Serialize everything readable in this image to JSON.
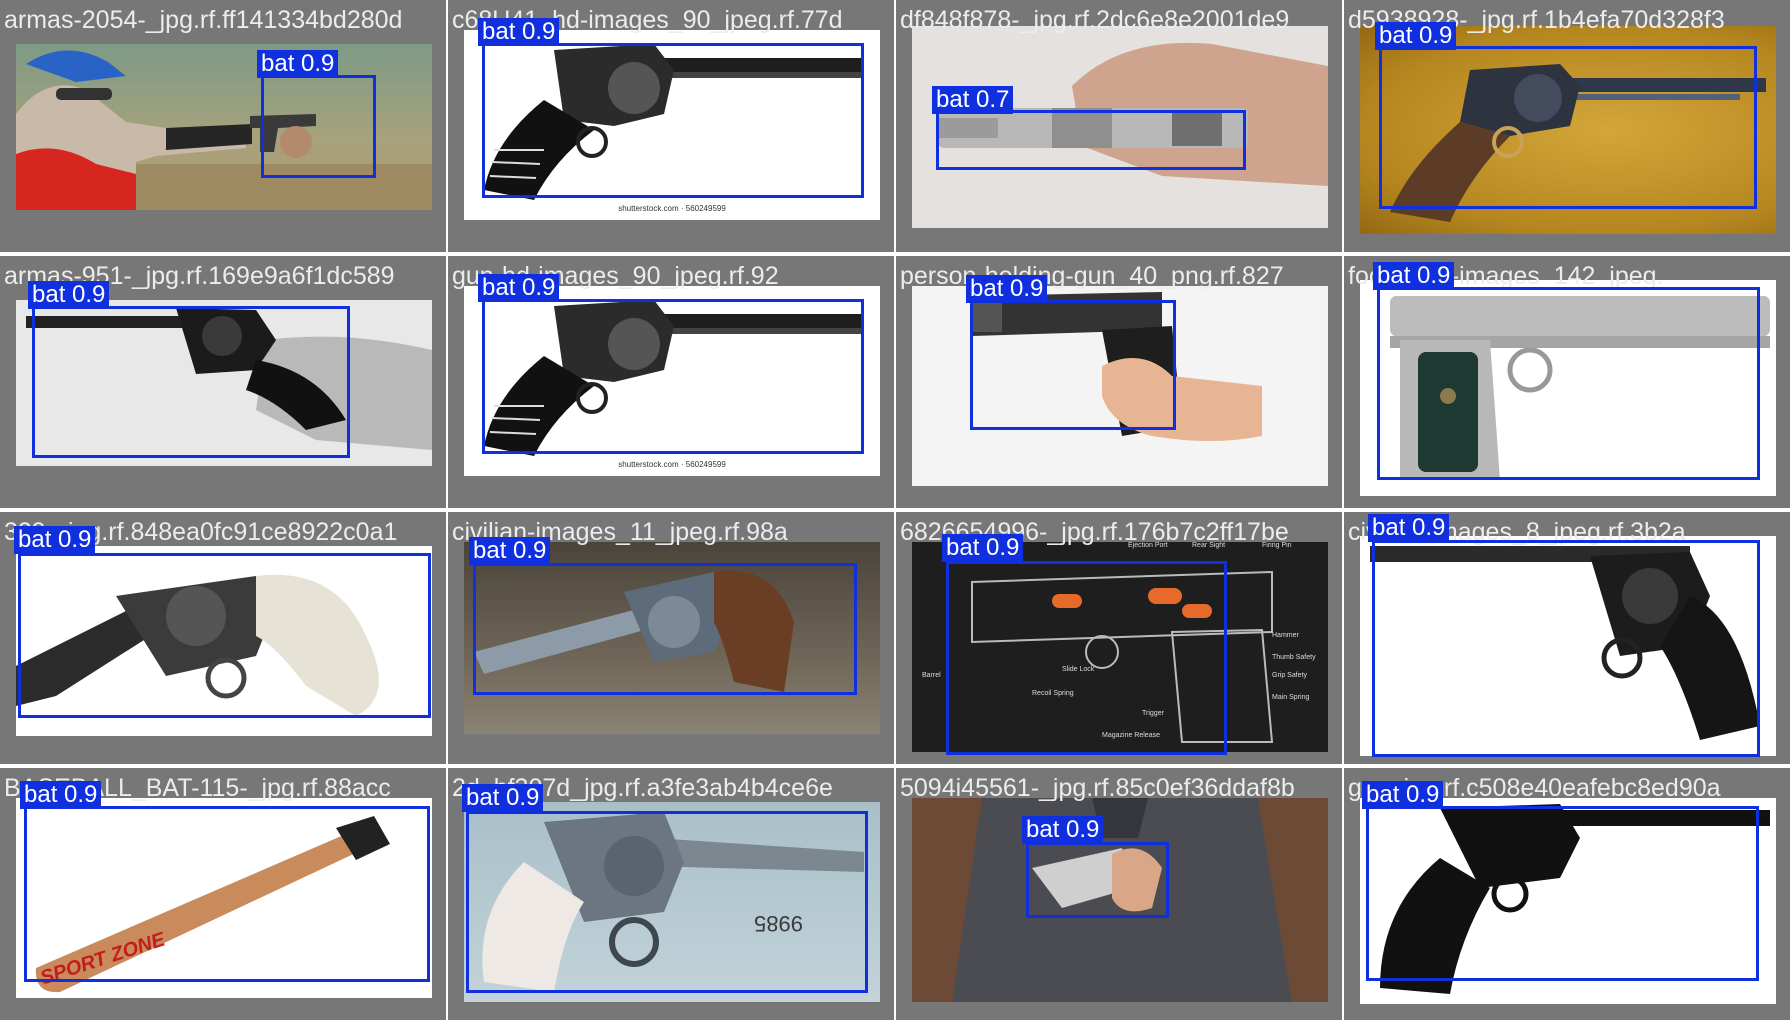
{
  "colors": {
    "mosaic_background": "#777777",
    "detection_box": "#1030e0",
    "detection_tag_text": "#ffffff",
    "filename_text": "#ececec"
  },
  "tiles": [
    {
      "filename": "armas-2054-_jpg.rf.ff141334bd280d",
      "detection": {
        "label": "bat",
        "confidence": "0.9",
        "tag": "bat 0.9"
      },
      "scene": "boy shooting handgun outdoors"
    },
    {
      "filename": "c68U41_hd-images_90_jpeg.rf.77d",
      "detection": {
        "label": "bat",
        "confidence": "0.9",
        "tag": "bat 0.9"
      },
      "scene": "engraved revolver illustration",
      "caption": "shutterstock.com · 560249599"
    },
    {
      "filename": "df848f878-_jpg.rf.2dc6e8e2001de9",
      "detection": {
        "label": "bat",
        "confidence": "0.7",
        "tag": "bat 0.7"
      },
      "scene": "hand holding silver pistol top view"
    },
    {
      "filename": "d5938928-_jpg.rf.1b4efa70d328f3",
      "detection": {
        "label": "bat",
        "confidence": "0.9",
        "tag": "bat 0.9"
      },
      "scene": "single action revolver on gold cloth"
    },
    {
      "filename": "armas-951-_jpg.rf.169e9a6f1dc589",
      "detection": {
        "label": "bat",
        "confidence": "0.9",
        "tag": "bat 0.9"
      },
      "scene": "black and white hand holding revolver"
    },
    {
      "filename": "gun-hd-images_90_jpeg.rf.92",
      "detection": {
        "label": "bat",
        "confidence": "0.9",
        "tag": "bat 0.9"
      },
      "scene": "engraved revolver illustration",
      "caption": "shutterstock.com · 560249599"
    },
    {
      "filename": "person-holding-gun_40_png.rf.827",
      "detection": {
        "label": "bat",
        "confidence": "0.9",
        "tag": "bat 0.9"
      },
      "scene": "hand holding semi-automatic pistol"
    },
    {
      "filename": "footballer-images_142_jpeg.",
      "detection": {
        "label": "bat",
        "confidence": "0.9",
        "tag": "bat 0.9"
      },
      "scene": "long barrel stainless pistol"
    },
    {
      "filename": "329-_jpg.rf.848ea0fc91ce8922c0a1",
      "detection": {
        "label": "bat",
        "confidence": "0.9",
        "tag": "bat 0.9"
      },
      "scene": "revolver with ivory grip"
    },
    {
      "filename": "civilian-images_11_jpeg.rf.98a",
      "detection": {
        "label": "bat",
        "confidence": "0.9",
        "tag": "bat 0.9"
      },
      "scene": "blued revolver on rock"
    },
    {
      "filename": "6826654996-_jpg.rf.176b7c2ff17be",
      "detection": {
        "label": "bat",
        "confidence": "0.9",
        "tag": "bat 0.9"
      },
      "scene": "pistol cutaway diagram",
      "diagram_labels": [
        "Ejection Port",
        "Rear Sight",
        "Firing Pin",
        "Hammer",
        "Thumb Safety",
        "Grip Safety",
        "Main Spring",
        "Barrel",
        "Slide Lock",
        "Recoil Spring",
        "Trigger",
        "Magazine Release"
      ]
    },
    {
      "filename": "civilian-images_8_jpeg.rf.3b2a",
      "detection": {
        "label": "bat",
        "confidence": "0.9",
        "tag": "bat 0.9"
      },
      "scene": "long barrel black revolver"
    },
    {
      "filename": "BASEBALL_BAT-115-_jpg.rf.88acc",
      "detection": {
        "label": "bat",
        "confidence": "0.9",
        "tag": "bat 0.9"
      },
      "scene": "wooden baseball bat",
      "bat_text": "SPORT ZONE"
    },
    {
      "filename": "2d_bf307d_jpg.rf.a3fe3ab4b4ce6e",
      "detection": {
        "label": "bat",
        "confidence": "0.9",
        "tag": "bat 0.9"
      },
      "scene": "revolver with pearl grip",
      "serial_text": "9985"
    },
    {
      "filename": "5094i45561-_jpg.rf.85c0ef36ddaf8b",
      "detection": {
        "label": "bat",
        "confidence": "0.9",
        "tag": "bat 0.9"
      },
      "scene": "man in suit hiding pistol behind back"
    },
    {
      "filename": "gun_jpg.rf.c508e40eafebc8ed90a",
      "detection": {
        "label": "bat",
        "confidence": "0.9",
        "tag": "bat 0.9"
      },
      "scene": "black and white revolver silhouette"
    }
  ]
}
